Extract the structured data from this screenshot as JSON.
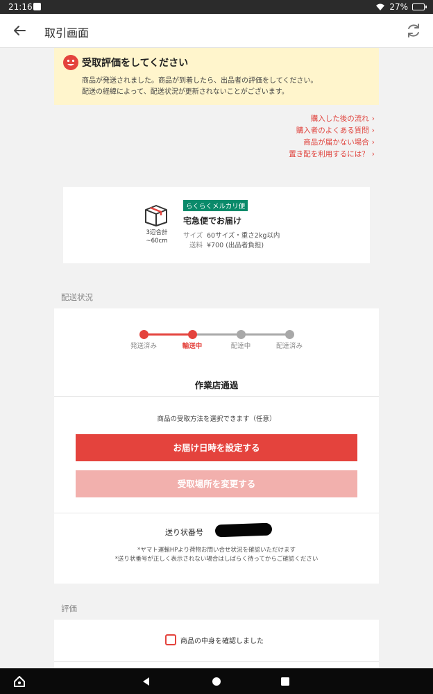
{
  "status_bar": {
    "time": "21:16",
    "battery": "27%"
  },
  "app_bar": {
    "title": "取引画面"
  },
  "notice": {
    "title": "受取評価をしてください",
    "line1": "商品が発送されました。商品が到着したら、出品者の評価をしてください。",
    "line2": "配送の経緯によって、配送状況が更新されないことがございます。"
  },
  "help_links": [
    "購入した後の流れ",
    "購入者のよくある質問",
    "商品が届かない場合",
    "置き配を利用するには？"
  ],
  "shipping": {
    "box_label_1": "3辺合計",
    "box_label_2": "~60cm",
    "badge": "らくらくメルカリ便",
    "service": "宅急便でお届け",
    "size_key": "サイズ",
    "size_value": "60サイズ・重さ2kg以内",
    "fee_key": "送料",
    "fee_value": "¥700 (出品者負担)"
  },
  "delivery_section": {
    "label": "配送状況"
  },
  "steps": [
    {
      "label": "発送済み",
      "active": true
    },
    {
      "label": "輸送中",
      "active": true,
      "current": true
    },
    {
      "label": "配達中",
      "active": false
    },
    {
      "label": "配達済み",
      "active": false
    }
  ],
  "status_title": "作業店通過",
  "receive_text": "商品の受取方法を選択できます（任意）",
  "buttons": {
    "set_delivery": "お届け日時を設定する",
    "change_location": "受取場所を変更する"
  },
  "tracking": {
    "label": "送り状番号",
    "note1": "*ヤマト運輸HPより荷物お問い合せ状況を確認いただけます",
    "note2": "*送り状番号が正しく表示されない場合はしばらく待ってからご確認ください"
  },
  "evaluation_section": {
    "label": "評価",
    "checkbox_label": "商品の中身を確認しました"
  },
  "colors": {
    "accent": "#e4433d",
    "accent_light": "#f2b0ad",
    "badge": "#0a8a6a",
    "notice_bg": "#fff5cc"
  }
}
